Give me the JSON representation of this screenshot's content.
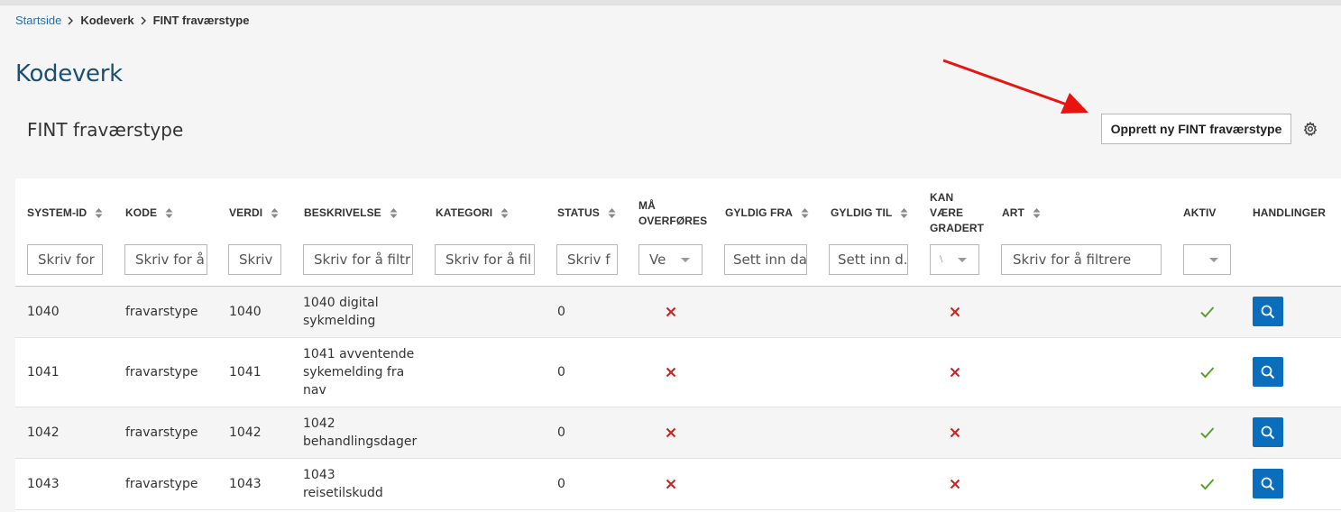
{
  "breadcrumb": {
    "home": "Startside",
    "level1": "Kodeverk",
    "current": "FINT fraværstype"
  },
  "page": {
    "title": "Kodeverk",
    "subtitle": "FINT fraværstype",
    "create_label": "Opprett ny FINT fraværstype"
  },
  "columns": [
    {
      "label": "SYSTEM-ID",
      "filter": "Skriv for"
    },
    {
      "label": "KODE",
      "filter": "Skriv for å"
    },
    {
      "label": "VERDI",
      "filter": "Skriv"
    },
    {
      "label": "BESKRIVELSE",
      "filter": "Skriv for å filtr"
    },
    {
      "label": "KATEGORI",
      "filter": "Skriv for å fil"
    },
    {
      "label": "STATUS",
      "filter": "Skriv f"
    },
    {
      "label_lines": [
        "MÅ",
        "OVERFØRES"
      ],
      "filter": "Ve"
    },
    {
      "label": "GYLDIG FRA",
      "filter": "Sett inn da"
    },
    {
      "label": "GYLDIG TIL",
      "filter": "Sett inn d."
    },
    {
      "label_lines": [
        "KAN",
        "VÆRE",
        "GRADERT"
      ],
      "filter": "\\"
    },
    {
      "label": "ART",
      "filter": "Skriv for å filtrere"
    },
    {
      "label": "AKTIV",
      "filter": ""
    },
    {
      "label": "HANDLINGER"
    }
  ],
  "rows": [
    {
      "system_id": "1040",
      "kode": "fravarstype",
      "verdi": "1040",
      "beskrivelse": [
        "1040 digital",
        "sykmelding"
      ],
      "status": "0"
    },
    {
      "system_id": "1041",
      "kode": "fravarstype",
      "verdi": "1041",
      "beskrivelse": [
        "1041 avventende",
        "sykemelding fra",
        "nav"
      ],
      "status": "0"
    },
    {
      "system_id": "1042",
      "kode": "fravarstype",
      "verdi": "1042",
      "beskrivelse": [
        "1042",
        "behandlingsdager"
      ],
      "status": "0"
    },
    {
      "system_id": "1043",
      "kode": "fravarstype",
      "verdi": "1043",
      "beskrivelse": [
        "1043",
        "reisetilskudd"
      ],
      "status": "0"
    }
  ],
  "icons": {
    "breadcrumb_separator": "chevron-right-icon",
    "settings": "gear-icon",
    "sort": "sort-icon",
    "no": "close-icon",
    "yes": "check-icon",
    "view": "search-icon",
    "annotation": "arrow-icon"
  },
  "colors": {
    "link": "#2a6fa8",
    "title": "#1d4f73",
    "primary": "#0a6ebd",
    "no": "#cc1f1f",
    "yes": "#5aa02c",
    "arrow": "#e8140f"
  }
}
